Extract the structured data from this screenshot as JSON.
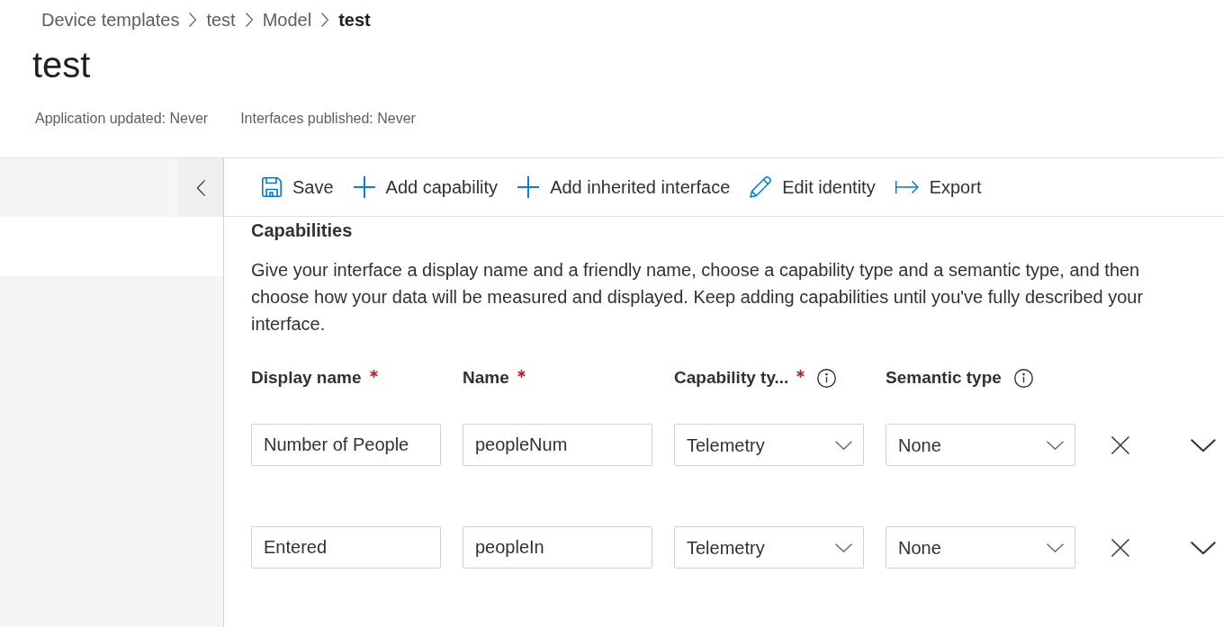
{
  "breadcrumb": [
    {
      "label": "Device templates",
      "current": false
    },
    {
      "label": "test",
      "current": false
    },
    {
      "label": "Model",
      "current": false
    },
    {
      "label": "test",
      "current": true
    }
  ],
  "title": "test",
  "status_items": [
    "Application updated: Never",
    "Interfaces published: Never"
  ],
  "toolbar": [
    {
      "kind": "save",
      "label": "Save"
    },
    {
      "kind": "add",
      "label": "Add capability"
    },
    {
      "kind": "add",
      "label": "Add inherited interface"
    },
    {
      "kind": "edit",
      "label": "Edit identity"
    },
    {
      "kind": "export",
      "label": "Export"
    }
  ],
  "capabilities": {
    "heading": "Capabilities",
    "description": "Give your interface a display name and a friendly name, choose a capability type and a semantic type, and then choose how your data will be measured and displayed. Keep adding capabilities until you've fully described your interface.",
    "columns": [
      {
        "label": "Display name",
        "required": true,
        "info": false
      },
      {
        "label": "Name",
        "required": true,
        "info": false
      },
      {
        "label": "Capability ty...",
        "required": true,
        "info": true
      },
      {
        "label": "Semantic type",
        "required": false,
        "info": true
      }
    ],
    "rows": [
      {
        "display_name": "Number of People",
        "name": "peopleNum",
        "capability_type": "Telemetry",
        "semantic_type": "None",
        "expanded": false
      },
      {
        "display_name": "Entered",
        "name": "peopleIn",
        "capability_type": "Telemetry",
        "semantic_type": "None",
        "expanded": false
      }
    ]
  }
}
